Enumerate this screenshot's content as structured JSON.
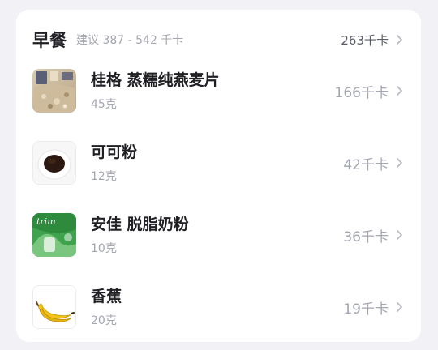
{
  "meal": {
    "title": "早餐",
    "suggestion": "建议 387 - 542 千卡",
    "total": "263千卡"
  },
  "foods": [
    {
      "name": "桂格 蒸糯纯燕麦片",
      "amount": "45克",
      "kcal": "166千卡",
      "image": "oat-package-image"
    },
    {
      "name": "可可粉",
      "amount": "12克",
      "kcal": "42千卡",
      "image": "cocoa-bowl-image"
    },
    {
      "name": "安佳 脱脂奶粉",
      "amount": "10克",
      "kcal": "36千卡",
      "image": "milk-powder-package-image"
    },
    {
      "name": "香蕉",
      "amount": "20克",
      "kcal": "19千卡",
      "image": "banana-image"
    }
  ],
  "colors": {
    "background": "#F2F2F6",
    "card": "#FFFFFF",
    "title_text": "#1F1F24",
    "secondary_text": "#A4A6B0",
    "chevron": "#B8BAC4"
  },
  "icons": {
    "chevron": "chevron-right-icon"
  }
}
